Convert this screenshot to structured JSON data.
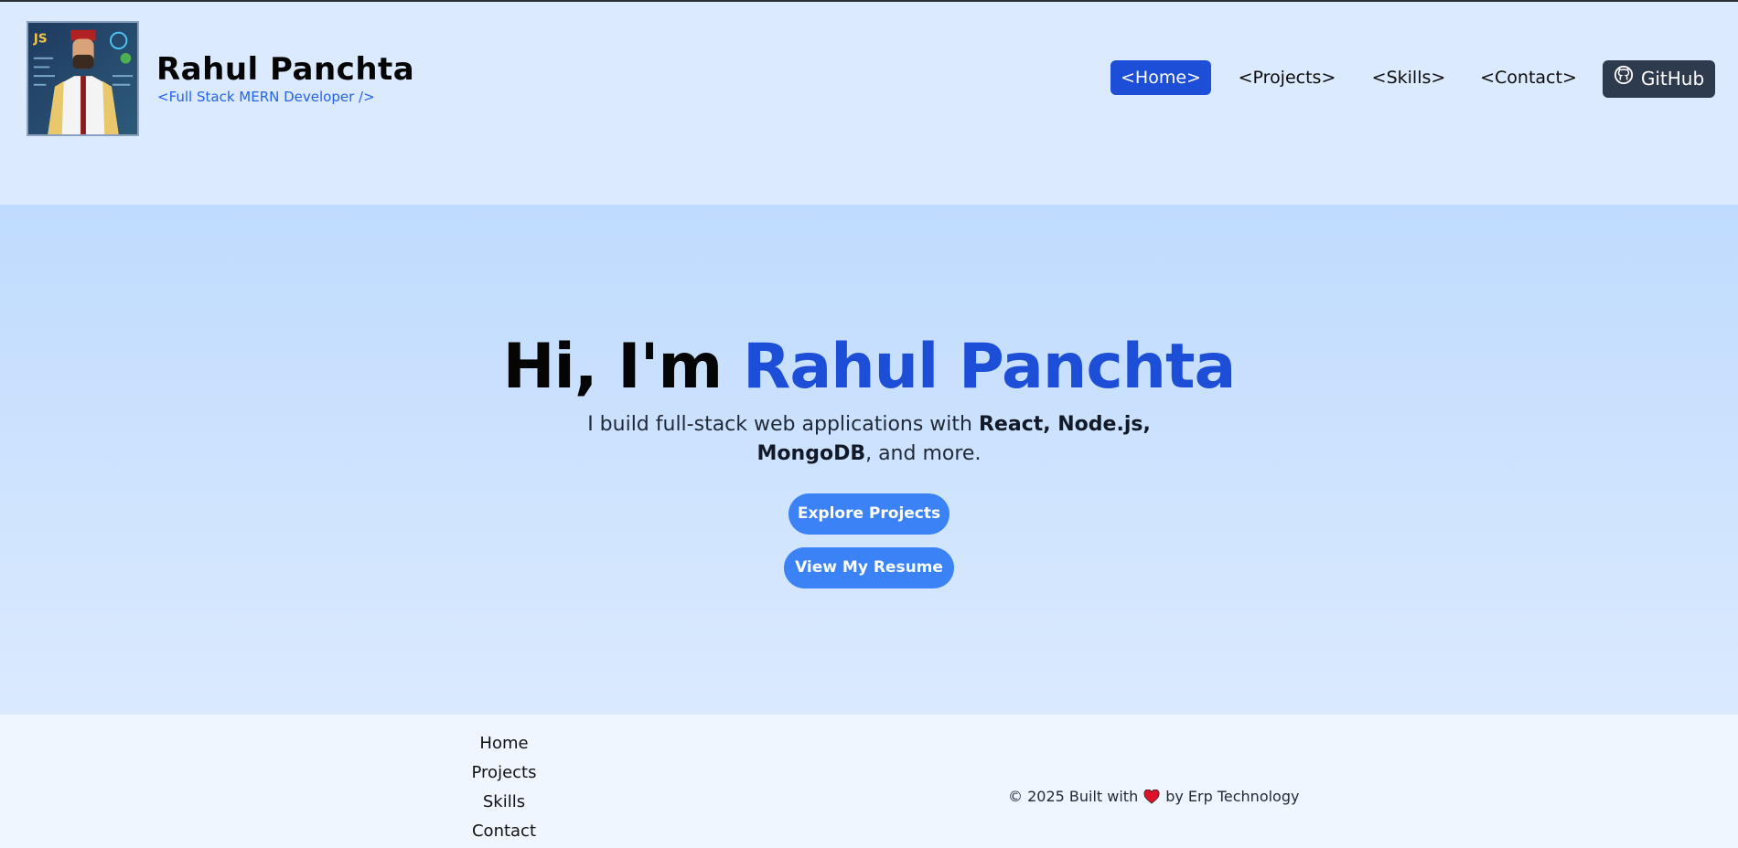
{
  "header": {
    "name": "Rahul Panchta",
    "tagline": "<Full Stack MERN Developer />",
    "nav": [
      {
        "label": "<Home>",
        "active": true
      },
      {
        "label": "<Projects>",
        "active": false
      },
      {
        "label": "<Skills>",
        "active": false
      },
      {
        "label": "<Contact>",
        "active": false
      }
    ],
    "github_label": "GitHub",
    "github_icon": "github-icon"
  },
  "hero": {
    "title_prefix": "Hi, I'm",
    "title_highlight": "Rahul Panchta",
    "subtitle_prefix": "I build full-stack web applications with",
    "subtitle_bold": "React, Node.js, MongoDB",
    "subtitle_suffix": ", and more.",
    "primary_button": "Explore Projects",
    "secondary_button": "View My Resume"
  },
  "footer": {
    "links": [
      "Home",
      "Projects",
      "Skills",
      "Contact"
    ],
    "copyright_prefix": "© 2025 Built with",
    "copyright_suffix": "by Erp Technology",
    "heart_icon": "heart-icon"
  },
  "colors": {
    "accent": "#1d4ed8",
    "button": "#3b82f6",
    "github_bg": "#2e3a4d",
    "header_bg": "#dbeafe"
  }
}
